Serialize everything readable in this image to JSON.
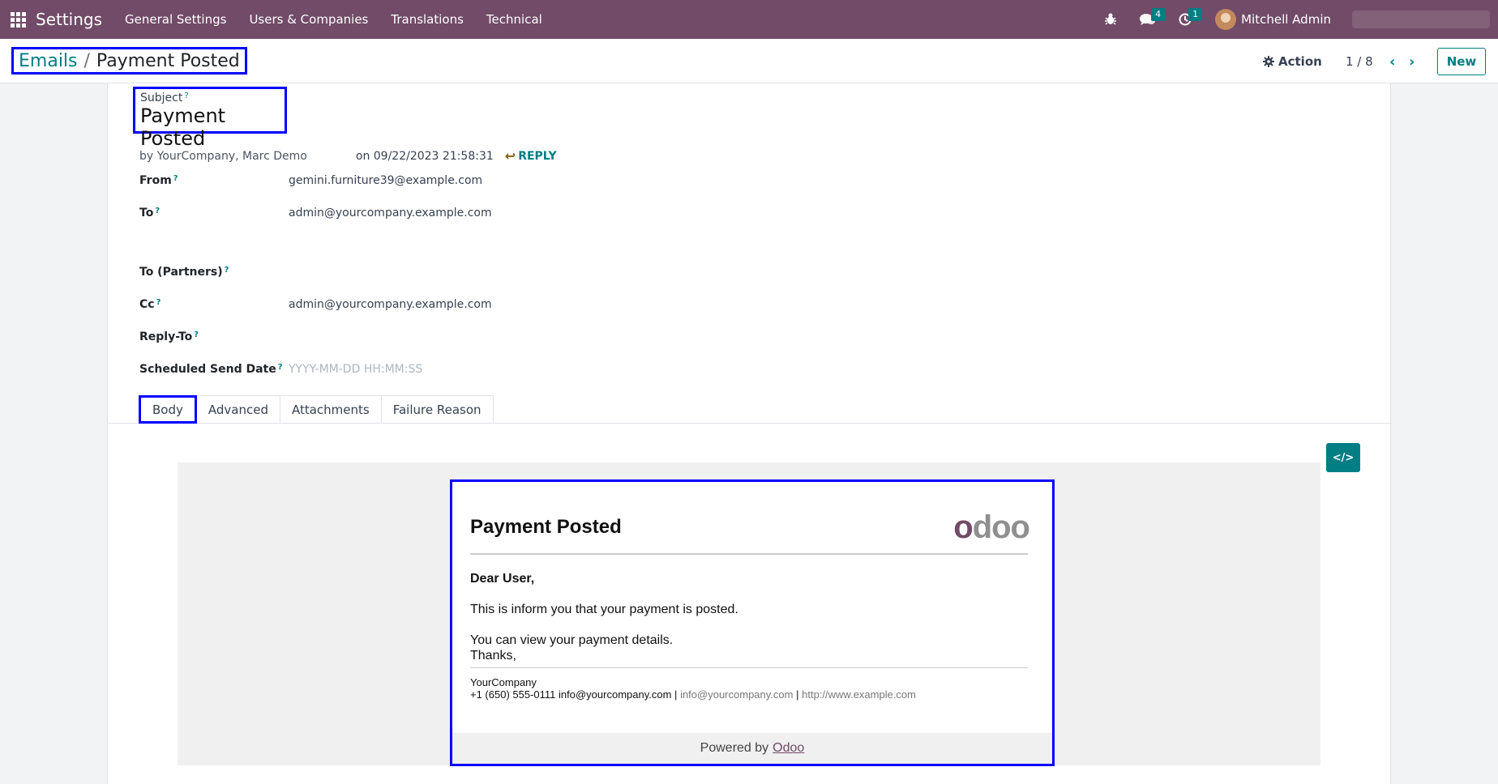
{
  "topbar": {
    "app_title": "Settings",
    "nav": [
      "General Settings",
      "Users & Companies",
      "Translations",
      "Technical"
    ],
    "messages_badge": "4",
    "activities_badge": "1",
    "user_name": "Mitchell Admin"
  },
  "control": {
    "breadcrumb_parent": "Emails",
    "breadcrumb_sep": "/",
    "breadcrumb_current": "Payment Posted",
    "action_label": "Action",
    "pager": "1 / 8",
    "new_label": "New"
  },
  "form": {
    "subject_label": "Subject",
    "subject_value": "Payment Posted",
    "author": "by YourCompany, Marc Demo",
    "date": "on 09/22/2023 21:58:31",
    "reply_label": "REPLY",
    "help_mark": "?",
    "fields": {
      "from": {
        "label": "From",
        "value": "gemini.furniture39@example.com"
      },
      "to": {
        "label": "To",
        "value": "admin@yourcompany.example.com"
      },
      "to_partners": {
        "label": "To (Partners)",
        "value": ""
      },
      "cc": {
        "label": "Cc",
        "value": "admin@yourcompany.example.com"
      },
      "reply_to": {
        "label": "Reply-To",
        "value": ""
      },
      "scheduled": {
        "label": "Scheduled Send Date",
        "placeholder": "YYYY-MM-DD HH:MM:SS"
      }
    }
  },
  "tabs": [
    "Body",
    "Advanced",
    "Attachments",
    "Failure Reason"
  ],
  "code_button": "</>",
  "email": {
    "title": "Payment Posted",
    "logo_first": "o",
    "logo_rest": "doo",
    "greeting": "Dear User,",
    "line1": "This is inform you that your payment is posted.",
    "line2": "You can view your payment details.",
    "line3": "Thanks,",
    "company": "YourCompany",
    "phone_email": "+1 (650) 555-0111 info@yourcompany.com",
    "sep": "|",
    "email_link": "info@yourcompany.com",
    "website": "http://www.example.com",
    "powered_by": "Powered by",
    "powered_link": "Odoo"
  },
  "colors": {
    "brand": "#714b67",
    "accent": "#017e84",
    "highlight": "#0000ff"
  }
}
